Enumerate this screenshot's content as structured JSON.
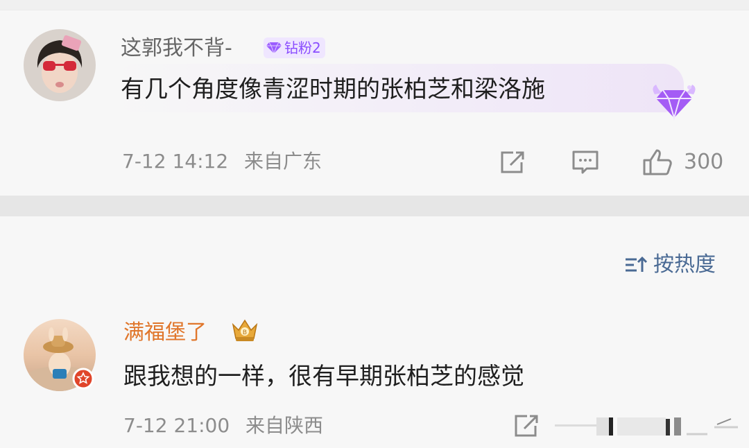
{
  "comments": [
    {
      "username": "这郭我不背-",
      "badge": "钻粉2",
      "text": "有几个角度像青涩时期的张柏芝和梁洛施",
      "time": "7-12 14:12",
      "location": "来自广东",
      "likes": "300",
      "username_color": "#666666"
    },
    {
      "username": "满福堡了",
      "text": "跟我想的一样，很有早期张柏芝的感觉",
      "time": "7-12 21:00",
      "location": "来自陕西",
      "username_color": "#e0762b"
    }
  ],
  "sort": {
    "label": "按热度"
  },
  "icons": [
    "share-icon",
    "comment-icon",
    "like-icon",
    "diamond-icon",
    "crown-icon",
    "sort-icon"
  ]
}
